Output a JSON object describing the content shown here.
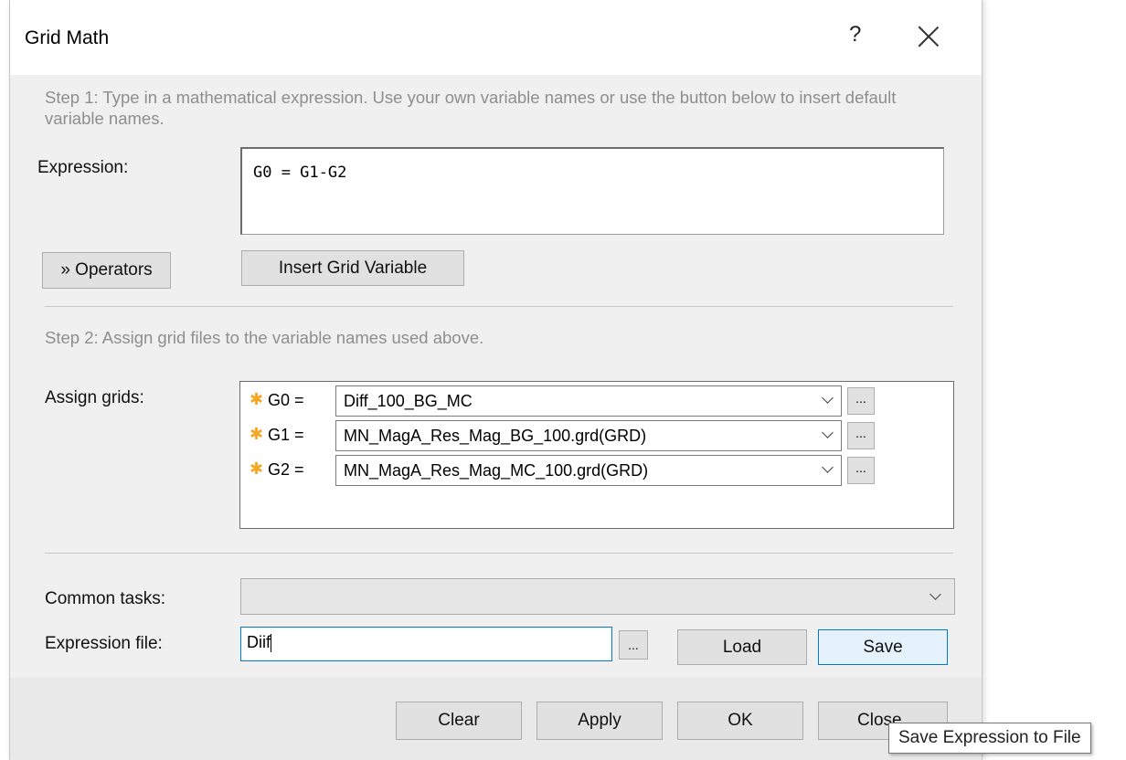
{
  "window": {
    "title": "Grid Math",
    "help_glyph": "?"
  },
  "step1": {
    "text": "Step 1: Type in a mathematical expression. Use your own variable names or use the button below to insert default variable names."
  },
  "expression": {
    "label": "Expression:",
    "value": "G0 = G1-G2"
  },
  "buttons": {
    "operators": "» Operators",
    "insert_grid_variable": "Insert Grid Variable",
    "load": "Load",
    "save": "Save",
    "clear": "Clear",
    "apply": "Apply",
    "ok": "OK",
    "close": "Close",
    "browse": "..."
  },
  "step2": {
    "text": "Step 2: Assign grid files to the variable names used above."
  },
  "assign": {
    "label": "Assign grids:",
    "rows": [
      {
        "var": "G0 =",
        "file": "Diff_100_BG_MC"
      },
      {
        "var": "G1 =",
        "file": "MN_MagA_Res_Mag_BG_100.grd(GRD)"
      },
      {
        "var": "G2 =",
        "file": "MN_MagA_Res_Mag_MC_100.grd(GRD)"
      }
    ]
  },
  "common_tasks": {
    "label": "Common tasks:",
    "value": ""
  },
  "expression_file": {
    "label": "Expression file:",
    "value": "Diif"
  },
  "tooltip": "Save Expression to File",
  "icons": {
    "close": "close-icon",
    "required": "asterisk-icon",
    "dropdown": "chevron-down-icon"
  },
  "colors": {
    "accent": "#0078d7",
    "required_star": "#f5a623"
  }
}
